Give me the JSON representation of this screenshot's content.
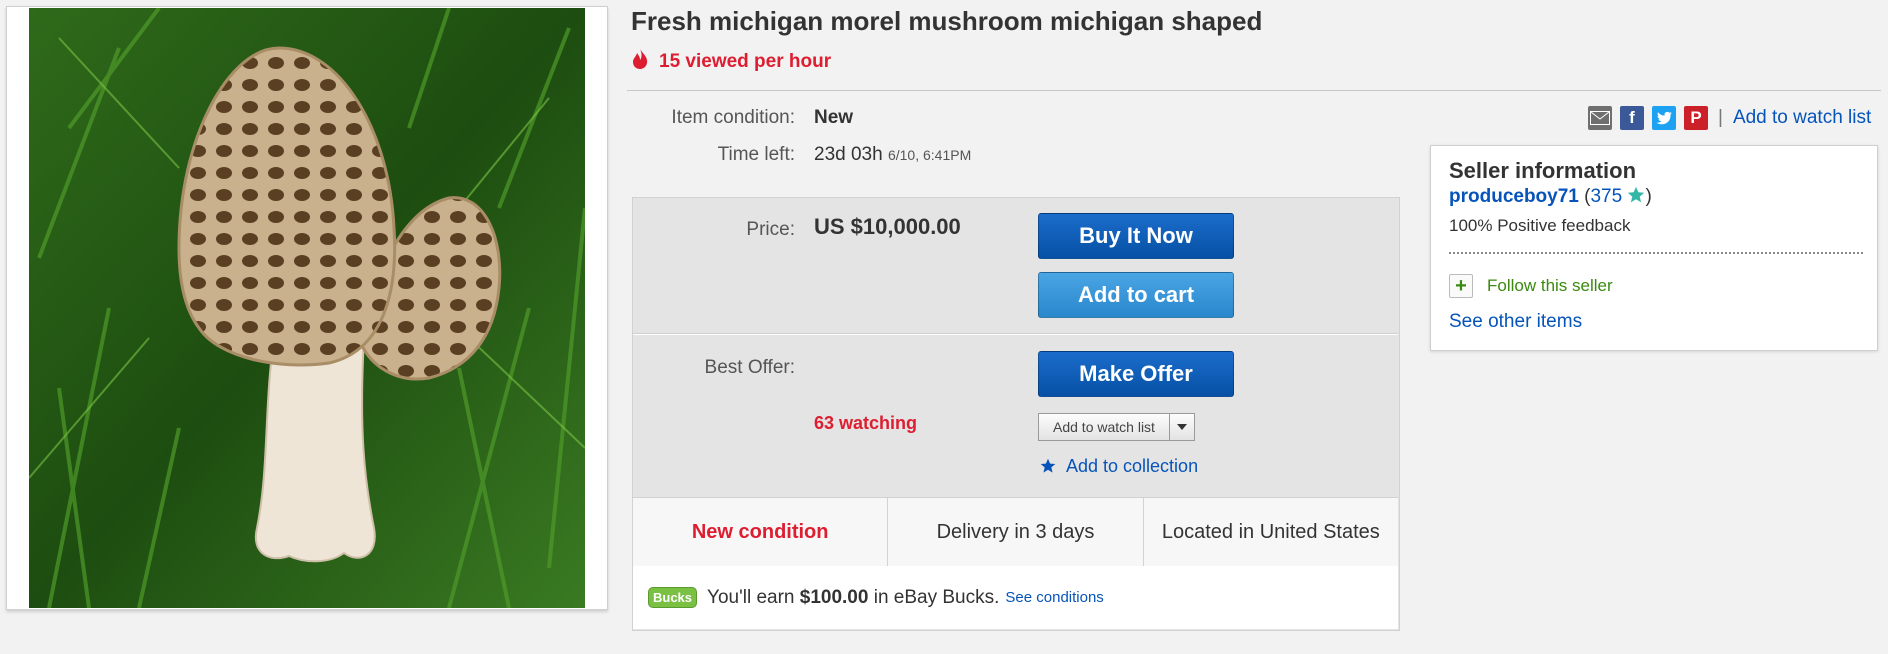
{
  "listing": {
    "title": "Fresh michigan morel mushroom michigan shaped",
    "views": "15 viewed per hour"
  },
  "details": {
    "condition_label": "Item condition:",
    "condition_value": "New",
    "time_label": "Time left:",
    "time_value": "23d 03h",
    "time_date": "6/10, 6:41PM"
  },
  "share": {
    "icons": [
      "email-icon",
      "facebook-icon",
      "twitter-icon",
      "pinterest-icon"
    ],
    "watch_link": "Add to watch list"
  },
  "buybox": {
    "price_label": "Price:",
    "price_value": "US $10,000.00",
    "buy_now": "Buy It Now",
    "add_to_cart": "Add to cart",
    "best_offer_label": "Best Offer:",
    "make_offer": "Make Offer",
    "watching": "63 watching",
    "watch_button": "Add to watch list",
    "collection": "Add to collection"
  },
  "strip": {
    "condition": "New condition",
    "delivery": "Delivery in 3 days",
    "location": "Located in United States"
  },
  "bucks": {
    "logo": "Bucks",
    "text_pre": "You'll earn",
    "amount": "$100.00",
    "text_post": "in eBay Bucks.",
    "link": "See conditions"
  },
  "seller": {
    "title": "Seller information",
    "name": "produceboy71",
    "feedback_count": "375",
    "positive": "100% Positive feedback",
    "follow": "Follow this seller",
    "other_items": "See other items"
  },
  "colors": {
    "accent_red": "#dd1e31",
    "link_blue": "#0654ba",
    "button_blue": "#0651a5",
    "button_light_blue": "#2a87cc",
    "star_teal": "#35b7a8",
    "follow_green": "#3a8a0f"
  }
}
